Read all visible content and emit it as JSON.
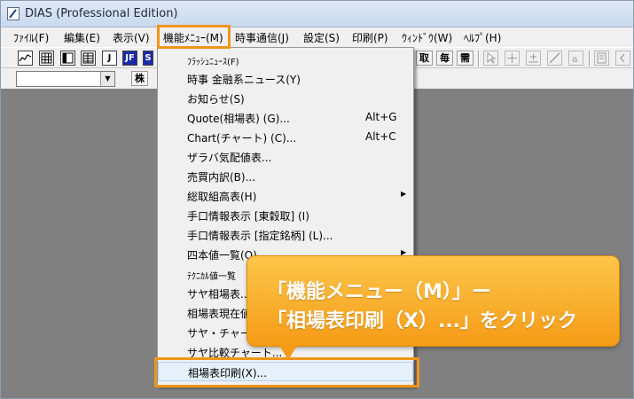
{
  "window": {
    "title": "DIAS (Professional Edition)"
  },
  "menubar": {
    "items": [
      {
        "label": "ﾌｧｲﾙ(F)"
      },
      {
        "label": "編集(E)"
      },
      {
        "label": "表示(V)"
      },
      {
        "label": "機能ﾒﾆｭｰ(M)"
      },
      {
        "label": "時事通信(J)"
      },
      {
        "label": "設定(S)"
      },
      {
        "label": "印刷(P)"
      },
      {
        "label": "ｳｨﾝﾄﾞｳ(W)"
      },
      {
        "label": "ﾍﾙﾌﾟ(H)"
      }
    ]
  },
  "toolbar": {
    "left_buttons": [
      "",
      "",
      "",
      "",
      "J",
      "JF",
      "S"
    ],
    "right_buttons": [
      "取",
      "毎",
      "需"
    ]
  },
  "toolbar2": {
    "button_label": "株"
  },
  "dropdown": {
    "items": [
      {
        "label": "ﾌﾗｯｼｭﾆｭｰｽ(F)",
        "shortcut": ""
      },
      {
        "label": "時事 金融系ニュース(Y)",
        "shortcut": ""
      },
      {
        "label": "お知らせ(S)",
        "shortcut": ""
      },
      {
        "label": "Quote(相場表) (G)...",
        "shortcut": "Alt+G"
      },
      {
        "label": "Chart(チャート) (C)...",
        "shortcut": "Alt+C"
      },
      {
        "label": "ザラバ気配値表...",
        "shortcut": ""
      },
      {
        "label": "売買内訳(B)...",
        "shortcut": ""
      },
      {
        "label": "総取組高表(H)",
        "shortcut": "",
        "submenu": "▶"
      },
      {
        "label": "手口情報表示 [東穀取] (I)",
        "shortcut": ""
      },
      {
        "label": "手口情報表示 [指定銘柄] (L)...",
        "shortcut": ""
      },
      {
        "label": "四本値一覧(O)",
        "shortcut": "",
        "submenu": "▶"
      },
      {
        "label": "ﾃｸﾆｶﾙ値一覧",
        "shortcut": ""
      },
      {
        "label": "サヤ相場表...",
        "shortcut": ""
      },
      {
        "label": "相場表現在値",
        "shortcut": ""
      },
      {
        "label": "サヤ・チャート",
        "shortcut": ""
      },
      {
        "label": "サヤ比較チャート...",
        "shortcut": ""
      },
      {
        "label": "相場表印刷(X)...",
        "shortcut": ""
      }
    ]
  },
  "callout": {
    "line1": "「機能メニュー（M）」ー",
    "line2": "「相場表印刷（X）...」をクリック"
  },
  "colors": {
    "accent": "#f0951a",
    "callout_top": "#fcc64a",
    "callout_bottom": "#f69b17"
  }
}
